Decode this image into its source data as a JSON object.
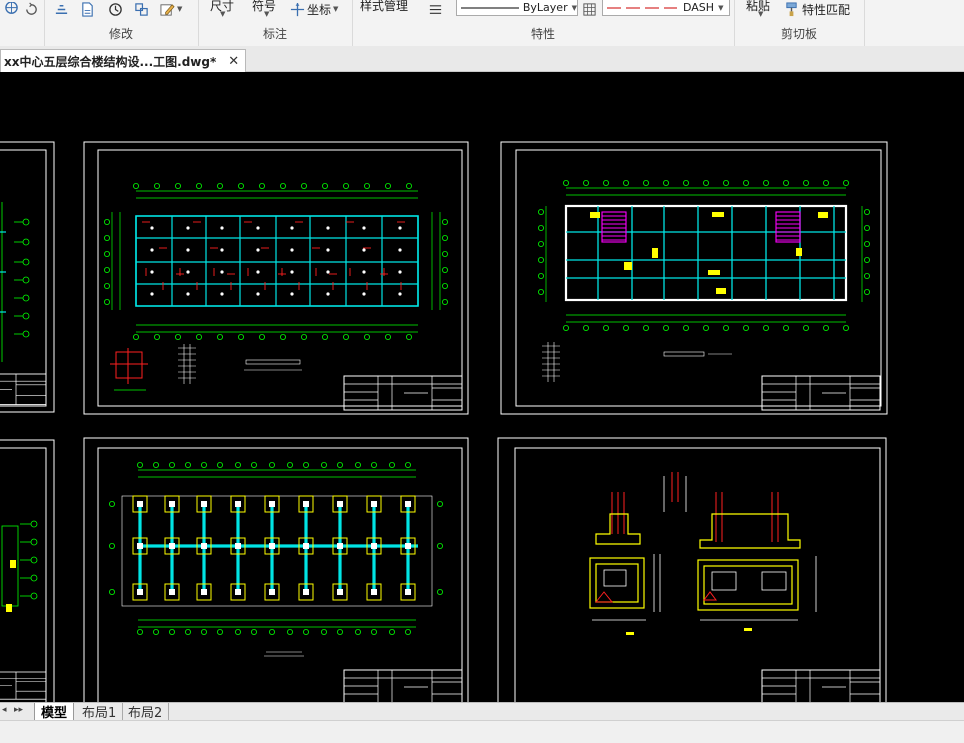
{
  "ribbon": {
    "modify": {
      "label": "修改"
    },
    "annotate": {
      "label": "标注",
      "dim_label": "尺寸",
      "symbol_label": "符号",
      "coord_label": "坐标"
    },
    "properties": {
      "label": "特性",
      "style_mgr_label": "样式管理",
      "layer_value": "ByLayer",
      "linetype_value": "DASH"
    },
    "clipboard": {
      "label": "剪切板",
      "paste_label": "粘贴",
      "match_label": "特性匹配"
    }
  },
  "document": {
    "tab_title": "xx中心五层综合楼结构设...工图.dwg*",
    "close_glyph": "✕"
  },
  "layout_tabs": [
    {
      "label": "模型",
      "active": true
    },
    {
      "label": "布局1",
      "active": false
    },
    {
      "label": "布局2",
      "active": false
    }
  ],
  "nav": {
    "first": "◂",
    "prev": "▸▸"
  },
  "colors": {
    "cad_background": "#000000",
    "sheet_border": "#ffffff",
    "axis_green": "#00ff00",
    "column_cyan": "#00e5e5",
    "rebar_red": "#ff2020",
    "highlight_yellow": "#ffff00",
    "hatch_magenta": "#ff00ff"
  }
}
